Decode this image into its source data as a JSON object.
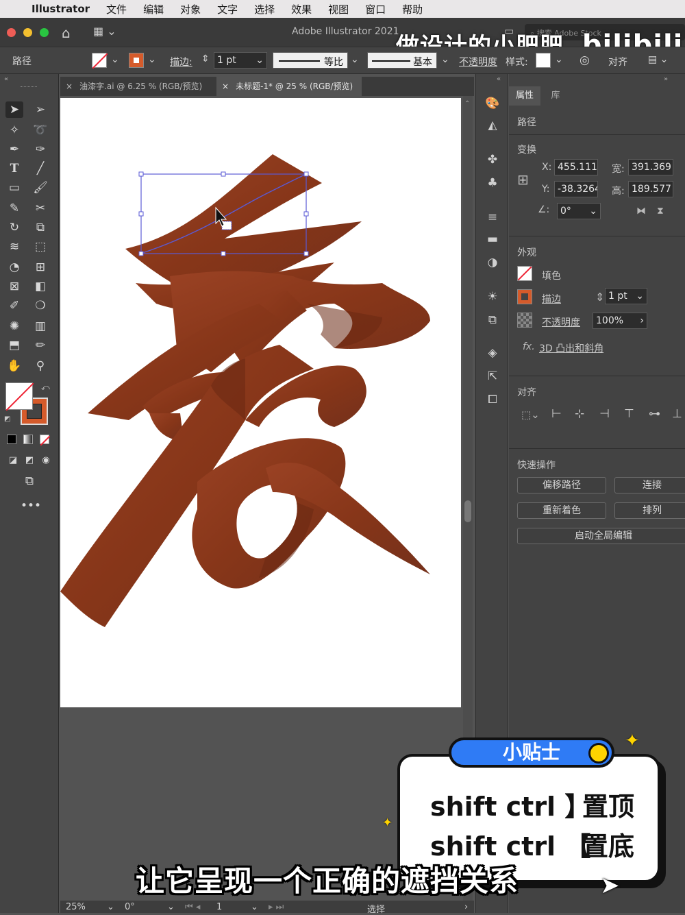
{
  "menubar": {
    "app": "Illustrator",
    "items": [
      "文件",
      "编辑",
      "对象",
      "文字",
      "选择",
      "效果",
      "视图",
      "窗口",
      "帮助"
    ]
  },
  "titlebar": {
    "title": "Adobe Illustrator 2021",
    "search_placeholder": "搜索 Adobe Stock"
  },
  "watermark": {
    "text": "做设计的小肥肥",
    "brand": "bilibili"
  },
  "controlbar": {
    "object_label": "路径",
    "stroke_label": "描边:",
    "stroke_value": "1 pt",
    "profile_label": "等比",
    "brush_label": "基本",
    "opacity_label": "不透明度",
    "style_label": "样式:",
    "align_label": "对齐"
  },
  "tabs": [
    {
      "label": "油漆字.ai @ 6.25 % (RGB/预览)",
      "active": false
    },
    {
      "label": "未标题-1* @ 25 % (RGB/预览)",
      "active": true
    }
  ],
  "properties": {
    "tab_properties": "属性",
    "tab_library": "库",
    "object_type": "路径",
    "transform": {
      "title": "变换",
      "x_label": "X:",
      "x_value": "455.111",
      "y_label": "Y:",
      "y_value": "-38.3264",
      "w_label": "宽:",
      "w_value": "391.369",
      "h_label": "高:",
      "h_value": "189.577",
      "angle_label": "∠:",
      "angle_value": "0°"
    },
    "appearance": {
      "title": "外观",
      "fill_label": "填色",
      "stroke_label": "描边",
      "stroke_value": "1 pt",
      "opacity_label": "不透明度",
      "opacity_value": "100%",
      "effect_label": "3D 凸出和斜角"
    },
    "align": {
      "title": "对齐"
    },
    "quick_actions": {
      "title": "快速操作",
      "offset_path": "偏移路径",
      "join": "连接",
      "recolor": "重新着色",
      "arrange": "排列",
      "global_edit": "启动全局编辑"
    }
  },
  "statusbar": {
    "zoom": "25%",
    "rotation": "0°",
    "artboard_num": "1",
    "mode": "选择"
  },
  "tip": {
    "badge": "小贴士",
    "line1_keys": "shift ctrl 】",
    "line1_action": "置顶",
    "line2_keys": "shift ctrl 【",
    "line2_action": "置底"
  },
  "subtitle": "让它呈现一个正确的遮挡关系",
  "colors": {
    "artwork": "#8f3a1f",
    "artwork_shadow": "#6e2a14",
    "stroke_swatch": "#d55b2b",
    "selection": "#5a5ad6",
    "tip_badge": "#2f7bf5",
    "tip_dot": "#ffd400"
  }
}
